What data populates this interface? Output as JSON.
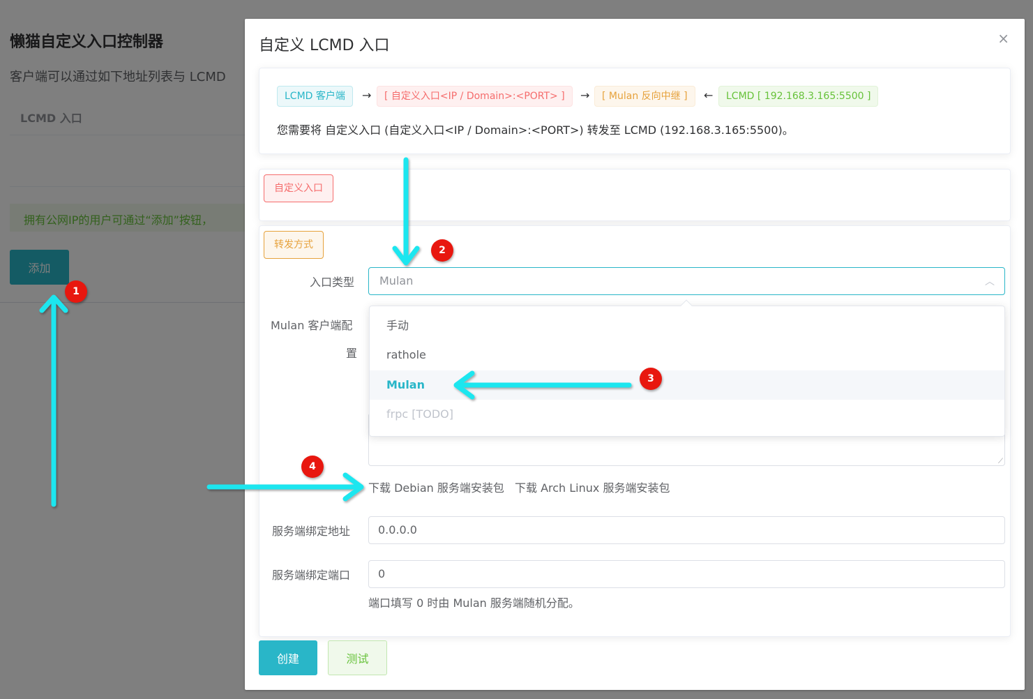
{
  "background": {
    "title": "懒猫自定义入口控制器",
    "description": "客户端可以通过如下地址列表与 LCMD",
    "table_header": "LCMD 入口",
    "alert": "拥有公网IP的用户可通过“添加”按钮，",
    "add_button": "添加"
  },
  "dialog": {
    "title": "自定义 LCMD 入口",
    "close_icon": "×",
    "flow": {
      "client": "LCMD 客户端",
      "custom_entry": "[ 自定义入口<IP / Domain>:<PORT> ]",
      "relay": "[ Mulan 反向中继 ]",
      "lcmd": "LCMD [ 192.168.3.165:5500 ]",
      "arrow_right": "→",
      "arrow_left": "←",
      "description": "您需要将 自定义入口 (自定义入口<IP / Domain>:<PORT>) 转发至 LCMD (192.168.3.165:5500)。"
    },
    "section_custom_entry": "自定义入口",
    "section_forwarding": "转发方式",
    "form": {
      "entry_type_label": "入口类型",
      "entry_type_value": "Mulan",
      "client_config_label_line1": "Mulan 客户端配",
      "client_config_label_line2": "置",
      "download_debian": "下载 Debian 服务端安装包",
      "download_arch": "下载 Arch Linux 服务端安装包",
      "bind_addr_label": "服务端绑定地址",
      "bind_addr_value": "0.0.0.0",
      "bind_port_label": "服务端绑定端口",
      "bind_port_value": "0",
      "port_hint": "端口填写 0 时由 Mulan 服务端随机分配。"
    },
    "dropdown_options": [
      "手动",
      "rathole",
      "Mulan",
      "frpc [TODO]"
    ],
    "buttons": {
      "create": "创建",
      "test": "测试"
    }
  },
  "annotations": [
    "1",
    "2",
    "3",
    "4"
  ],
  "colors": {
    "accent": "#29b6c8",
    "annotation_arrow": "#1fe6ef",
    "annotation_badge": "#e8170f"
  },
  "icons": {
    "select_caret": "chevron-up-icon",
    "resize": "resize-handle-icon",
    "close": "close-icon"
  }
}
